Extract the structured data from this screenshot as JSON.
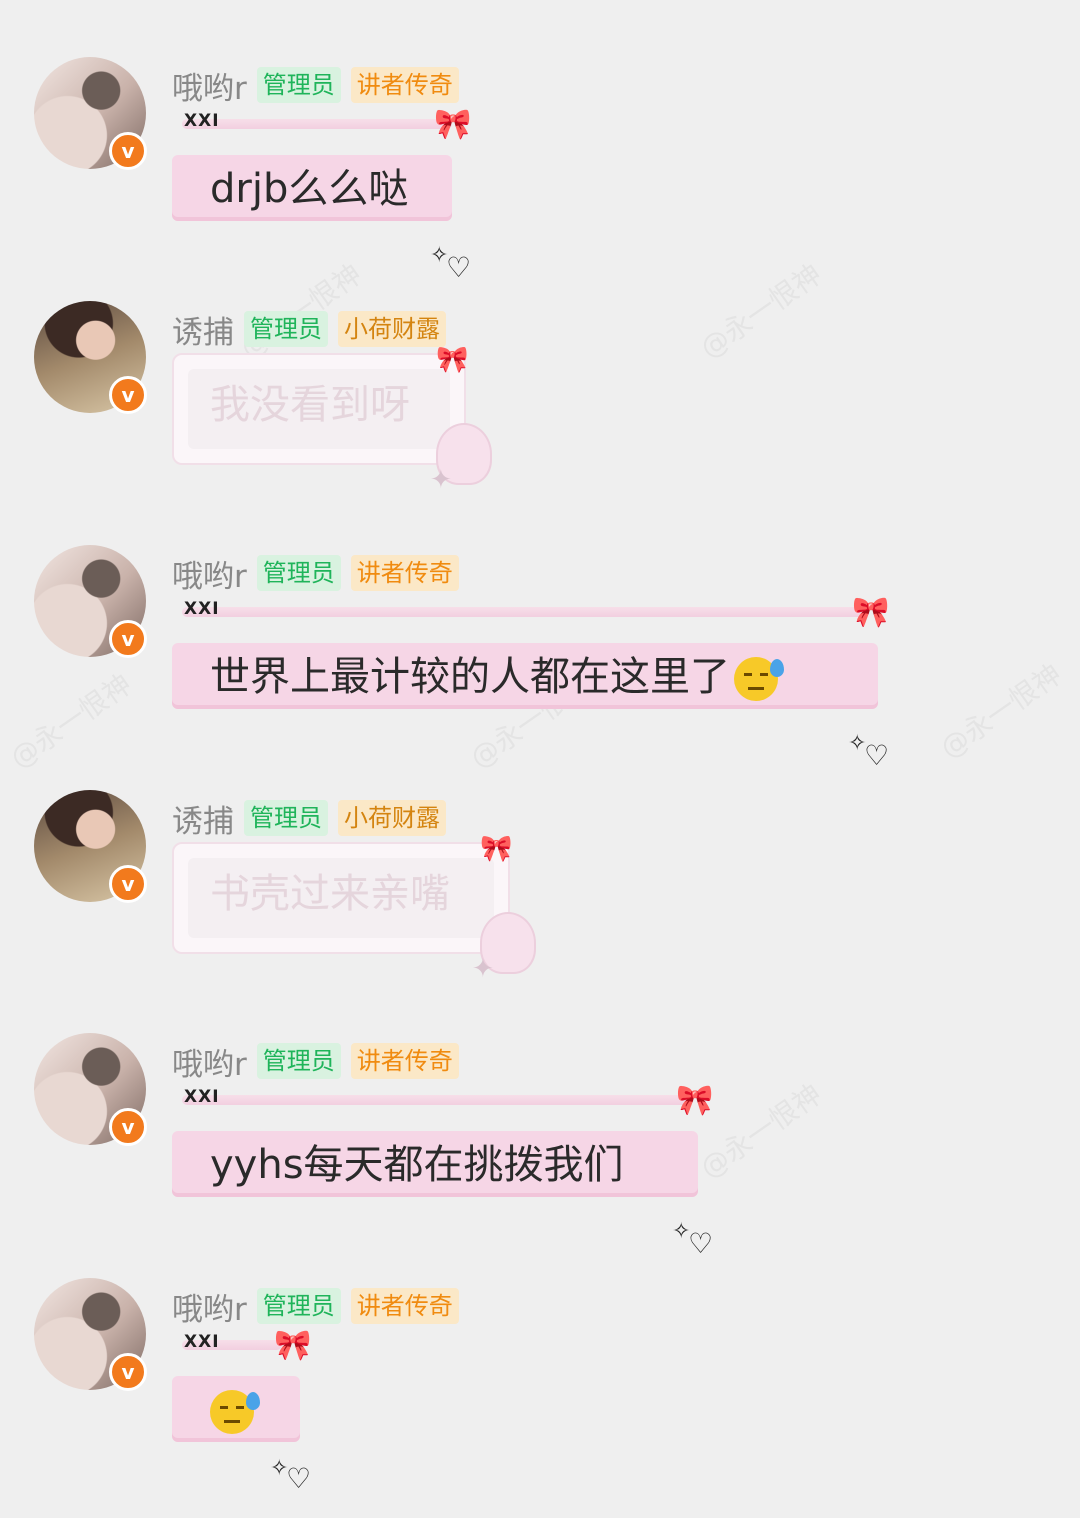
{
  "users": {
    "u1": {
      "name": "哦哟r",
      "tags": [
        "管理员",
        "讲者传奇"
      ]
    },
    "u2": {
      "name": "诱捕",
      "tags": [
        "管理员",
        "小荷财露"
      ]
    }
  },
  "bubble_label": "XXI",
  "verified_badge": "v",
  "watermark": "@永一恨神",
  "messages": [
    {
      "user": "哦哟r",
      "tag1": "管理员",
      "tag2": "讲者传奇",
      "text": "drjb么么哒"
    },
    {
      "user": "诱捕",
      "tag1": "管理员",
      "tag2": "小荷财露",
      "text": "我没看到呀"
    },
    {
      "user": "哦哟r",
      "tag1": "管理员",
      "tag2": "讲者传奇",
      "text": "世界上最计较的人都在这里了"
    },
    {
      "user": "诱捕",
      "tag1": "管理员",
      "tag2": "小荷财露",
      "text": "书壳过来亲嘴"
    },
    {
      "user": "哦哟r",
      "tag1": "管理员",
      "tag2": "讲者传奇",
      "text": "yyhs每天都在挑拨我们"
    },
    {
      "user": "哦哟r",
      "tag1": "管理员",
      "tag2": "讲者传奇",
      "text": ""
    }
  ],
  "emojis": {
    "m3": "sweat-emoji",
    "m6": "sweat-emoji"
  },
  "colors": {
    "admin_bg": "#d9f2e0",
    "admin_text": "#1fb45a",
    "rank_bg": "#fbe8c7",
    "rank_text": "#f08b10",
    "verified": "#f27a1d",
    "bubble_pink": "#f6d6e6"
  }
}
